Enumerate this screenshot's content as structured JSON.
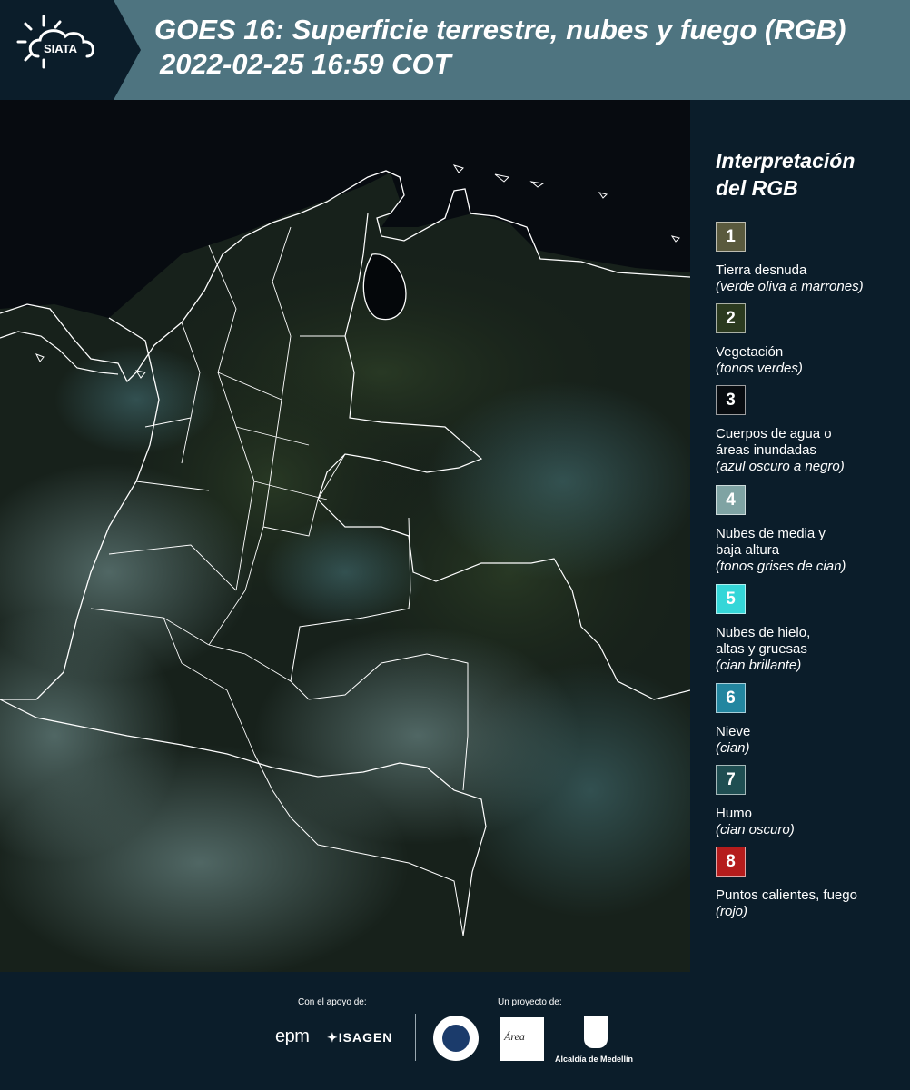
{
  "header": {
    "logo_text": "SIATA",
    "title_line1": "GOES 16: Superficie terrestre, nubes y fuego (RGB)",
    "title_line2": "2022-02-25 16:59 COT",
    "background_color": "#4e7480"
  },
  "legend": {
    "title_line1": "Interpretación",
    "title_line2": "del RGB",
    "items": [
      {
        "number": "1",
        "color": "#5a5a3e",
        "label_lines": [
          "Tierra desnuda"
        ],
        "sub": "(verde oliva a marrones)"
      },
      {
        "number": "2",
        "color": "#2b3a1f",
        "label_lines": [
          "Vegetación"
        ],
        "sub": "(tonos verdes)"
      },
      {
        "number": "3",
        "color": "#080c10",
        "label_lines": [
          "Cuerpos de agua o",
          "áreas inundadas"
        ],
        "sub": "(azul oscuro a negro)"
      },
      {
        "number": "4",
        "color": "#7fa3a3",
        "label_lines": [
          "Nubes de media y",
          "baja altura"
        ],
        "sub": "(tonos grises de cian)"
      },
      {
        "number": "5",
        "color": "#35d6d8",
        "label_lines": [
          "Nubes de hielo,",
          "altas y gruesas"
        ],
        "sub": "(cian brillante)"
      },
      {
        "number": "6",
        "color": "#2386a0",
        "label_lines": [
          "Nieve"
        ],
        "sub": "(cian)"
      },
      {
        "number": "7",
        "color": "#1f4e52",
        "label_lines": [
          "Humo"
        ],
        "sub": "(cian oscuro)"
      },
      {
        "number": "8",
        "color": "#b51c1c",
        "label_lines": [
          "Puntos calientes, fuego"
        ],
        "sub": "(rojo)"
      }
    ]
  },
  "footer": {
    "support_label": "Con el apoyo de:",
    "project_label": "Un proyecto de:",
    "sponsors": [
      "epm",
      "ISAGEN"
    ],
    "amva_mark": "Área",
    "alcaldia_label": "Alcaldía de Medellín"
  }
}
